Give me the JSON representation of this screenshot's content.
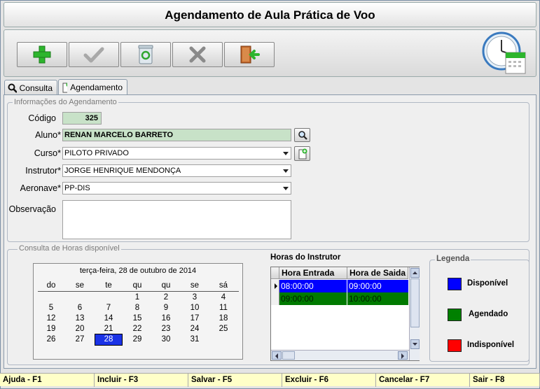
{
  "window": {
    "title": "Agendamento de Aula Prática de Voo"
  },
  "toolbar": {
    "buttons": [
      {
        "name": "incluir",
        "icon": "plus-icon"
      },
      {
        "name": "salvar",
        "icon": "check-icon"
      },
      {
        "name": "excluir",
        "icon": "recycle-bin-icon"
      },
      {
        "name": "cancelar",
        "icon": "x-icon"
      },
      {
        "name": "sair",
        "icon": "exit-door-icon"
      }
    ],
    "badge_icon": "clock-calendar-icon"
  },
  "tabs": [
    {
      "label": "Consulta",
      "icon": "search-icon"
    },
    {
      "label": "Agendamento",
      "icon": "new-document-icon",
      "active": true
    }
  ],
  "form": {
    "group_title": "Informações do Agendamento",
    "codigo": {
      "label": "Código",
      "value": "325"
    },
    "aluno": {
      "label": "Aluno*",
      "value": "RENAN MARCELO BARRETO"
    },
    "curso": {
      "label": "Curso*",
      "value": "PILOTO PRIVADO"
    },
    "instrutor": {
      "label": "Instrutor*",
      "value": "JORGE HENRIQUE MENDONÇA"
    },
    "aeronave": {
      "label": "Aeronave*",
      "value": "PP-DIS"
    },
    "observacao": {
      "label": "Observação",
      "value": ""
    }
  },
  "horas": {
    "group_title": "Consulta de Horas disponível",
    "calendar": {
      "header": "terça-feira, 28 de outubro de 2014",
      "weekdays": [
        "do",
        "se",
        "te",
        "qu",
        "qu",
        "se",
        "sá"
      ],
      "weeks": [
        [
          "",
          "",
          "",
          "1",
          "2",
          "3",
          "4"
        ],
        [
          "5",
          "6",
          "7",
          "8",
          "9",
          "10",
          "11"
        ],
        [
          "12",
          "13",
          "14",
          "15",
          "16",
          "17",
          "18"
        ],
        [
          "19",
          "20",
          "21",
          "22",
          "23",
          "24",
          "25"
        ],
        [
          "26",
          "27",
          "28",
          "29",
          "30",
          "31",
          ""
        ]
      ],
      "selected": "28"
    },
    "instrutor_title": "Horas do Instrutor",
    "grid": {
      "columns": [
        "Hora Entrada",
        "Hora de Saida"
      ],
      "rows": [
        {
          "entrada": "08:00:00",
          "saida": "09:00:00",
          "status": "disponivel"
        },
        {
          "entrada": "09:00:00",
          "saida": "10:00:00",
          "status": "agendado"
        }
      ]
    },
    "legend": {
      "title": "Legenda",
      "items": [
        {
          "label": "Disponível",
          "color": "#0000ff"
        },
        {
          "label": "Agendado",
          "color": "#008000"
        },
        {
          "label": "Indisponível",
          "color": "#ff0000"
        }
      ]
    }
  },
  "statusbar": [
    "Ajuda - F1",
    "Incluir - F3",
    "Salvar - F5",
    "Excluir - F6",
    "Cancelar - F7",
    "Sair - F8"
  ],
  "colors": {
    "disponivel": "#0000ff",
    "agendado": "#007a00",
    "status_bg": "#ffffc8"
  }
}
